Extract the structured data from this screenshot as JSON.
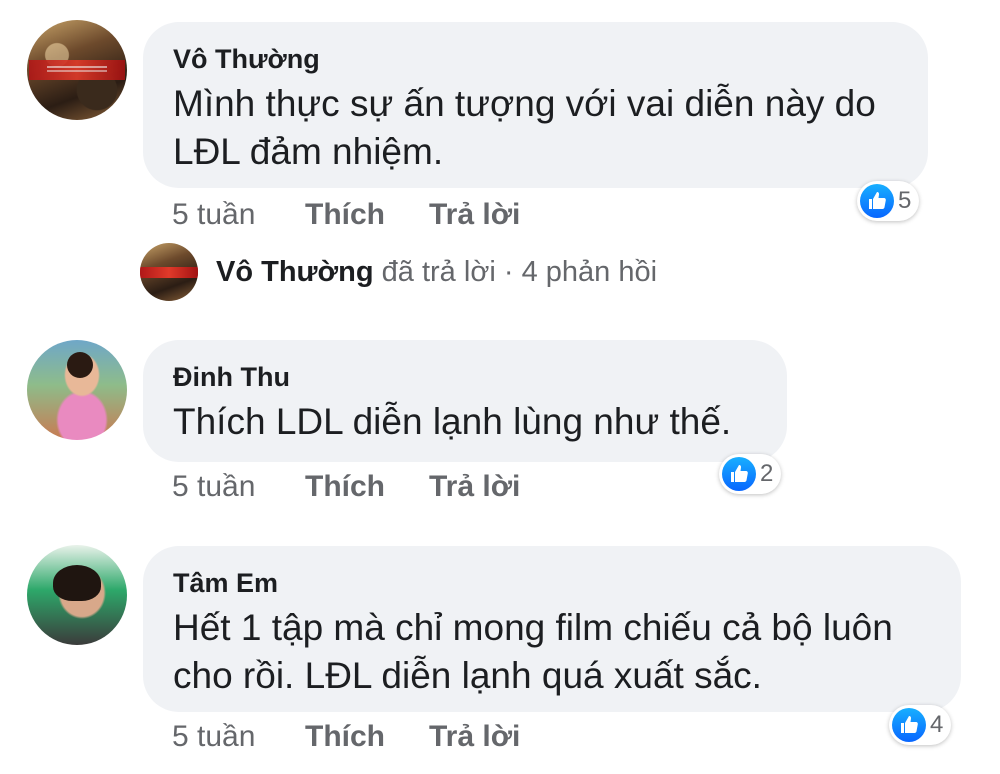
{
  "comments": [
    {
      "author": "Vô Thường",
      "text": "Mình thực sự ấn tượng với vai diễn này do\nLĐL đảm nhiệm.",
      "time": "5 tuần",
      "like_label": "Thích",
      "reply_label": "Trả lời",
      "reaction_count": "5"
    },
    {
      "author": "Đinh Thu",
      "text": "Thích LDL diễn lạnh lùng như thế.",
      "time": "5 tuần",
      "like_label": "Thích",
      "reply_label": "Trả lời",
      "reaction_count": "2"
    },
    {
      "author": "Tâm Em",
      "text": "Hết 1 tập mà chỉ mong film chiếu cả bộ luôn\ncho rồi. LĐL diễn lạnh quá xuất sắc.",
      "time": "5 tuần",
      "like_label": "Thích",
      "reply_label": "Trả lời",
      "reaction_count": "4"
    }
  ],
  "reply_thread": {
    "author": "Vô Thường",
    "action": "đã trả lời",
    "separator": "·",
    "count_text": "4 phản hồi"
  },
  "colors": {
    "bubble": "#f0f2f5",
    "like_blue": "#0866ff",
    "secondary_text": "#65676b",
    "primary_text": "#1c1e21"
  },
  "icons": {
    "reaction": "thumbs-up-icon"
  }
}
